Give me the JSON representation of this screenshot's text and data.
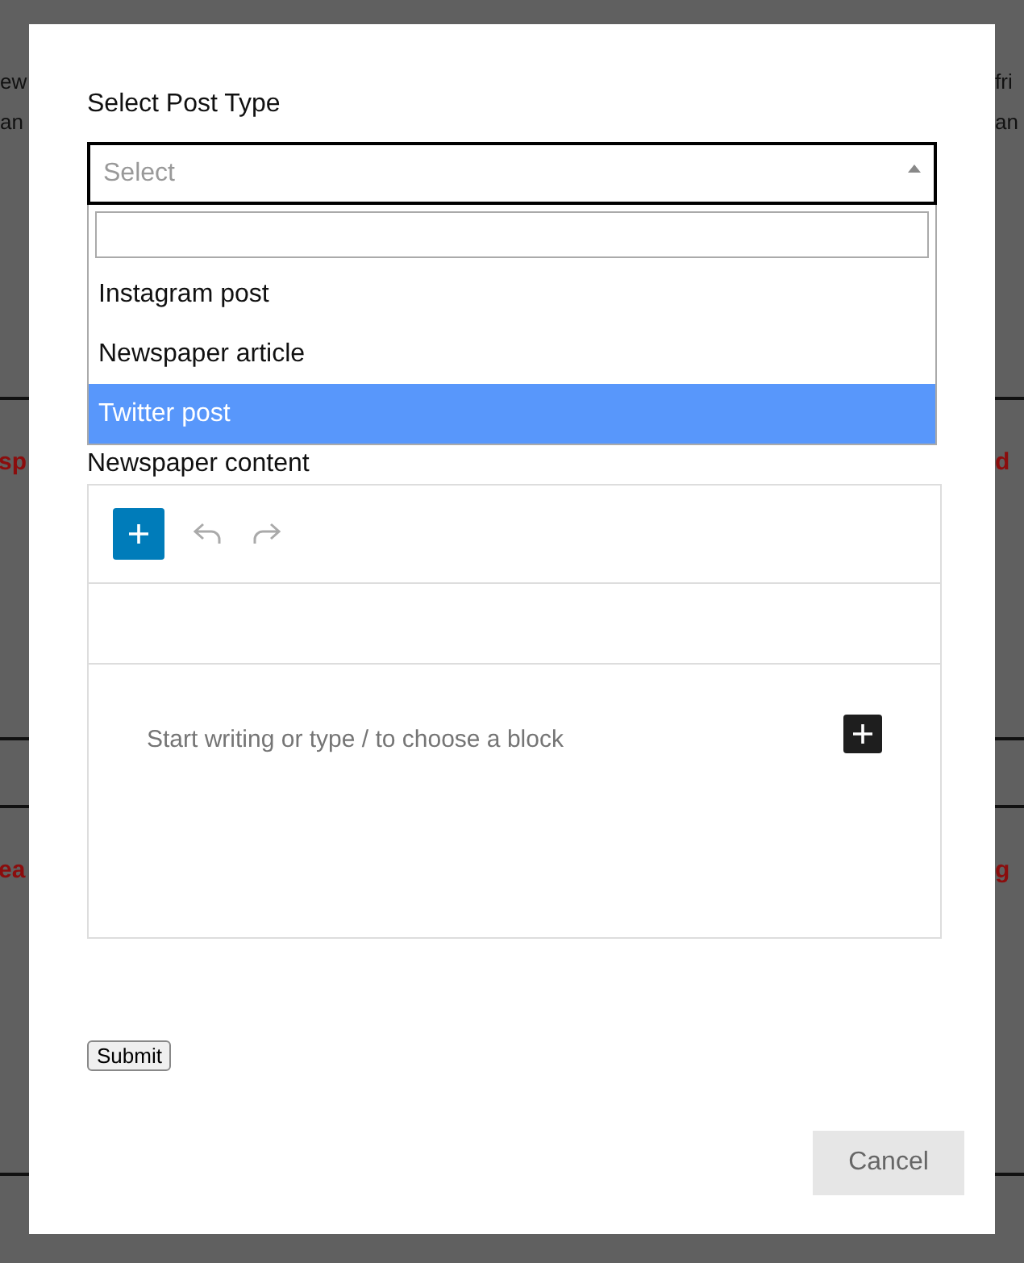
{
  "backdrop": {
    "sections": [
      {
        "kind": "text",
        "lines": [
          {
            "left": "ew",
            "right": "fri"
          },
          {
            "left": "an",
            "right": "an"
          }
        ]
      },
      {
        "kind": "heading",
        "lines": [
          {
            "left": "sp",
            "right": "d"
          }
        ]
      },
      {
        "kind": "empty"
      },
      {
        "kind": "heading",
        "lines": [
          {
            "left": "ea",
            "right": "g"
          }
        ]
      }
    ]
  },
  "modal": {
    "post_type": {
      "label": "Select Post Type",
      "placeholder": "Select",
      "expanded": true,
      "options": [
        {
          "label": "Instagram post",
          "selected": false
        },
        {
          "label": "Newspaper article",
          "selected": false
        },
        {
          "label": "Twitter post",
          "selected": true
        }
      ]
    },
    "content": {
      "label": "Newspaper content",
      "placeholder": "Start writing or type / to choose a block"
    },
    "submit": "Submit",
    "cancel": "Cancel"
  }
}
